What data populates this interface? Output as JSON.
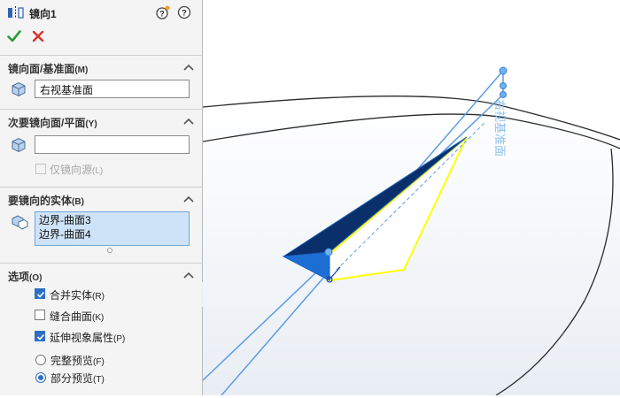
{
  "header": {
    "title": "镜向1",
    "icons": [
      "mirror-feature-icon",
      "whats-wrong-help-icon",
      "help-icon"
    ]
  },
  "actions": {
    "ok_icon": "check-icon",
    "cancel_icon": "close-icon"
  },
  "sections": {
    "mirror_plane": {
      "title": "镜向面/基准面",
      "title_key": "(M)",
      "value": "右视基准面"
    },
    "secondary_plane": {
      "title": "次要镜向面/平面",
      "title_key": "(Y)",
      "value": "",
      "mirror_source_only": "仅镜向源",
      "mirror_source_only_key": "(L)",
      "mirror_source_only_checked": false
    },
    "bodies": {
      "title": "要镜向的实体",
      "title_key": "(B)",
      "items": [
        "边界-曲面3",
        "边界-曲面4"
      ]
    },
    "options": {
      "title": "选项",
      "title_key": "(O)",
      "merge_solids": {
        "label": "合并实体",
        "key": "(R)",
        "checked": true
      },
      "knit_surfaces": {
        "label": "缝合曲面",
        "key": "(K)",
        "checked": false
      },
      "propagate_visual": {
        "label": "延伸视象属性",
        "key": "(P)",
        "checked": true
      },
      "full_preview": {
        "label": "完整预览",
        "key": "(F)",
        "selected": false
      },
      "partial_preview": {
        "label": "部分预览",
        "key": "(T)",
        "selected": true
      }
    }
  },
  "viewport": {
    "plane_label": "右视基准面"
  },
  "colors": {
    "accent": "#2e6fc4",
    "plane": "#5b9be6",
    "preview": "#ffff00",
    "surface": "#1a5fb4"
  }
}
